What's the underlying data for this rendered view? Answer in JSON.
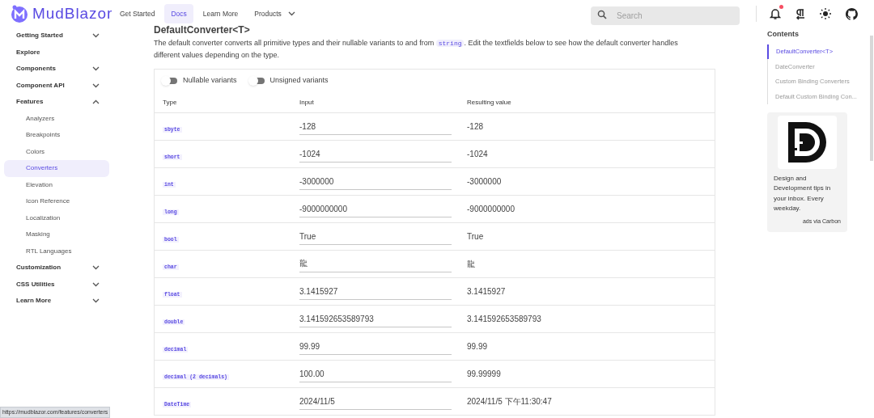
{
  "header": {
    "brand": "MudBlazor",
    "nav": [
      {
        "label": "Get Started",
        "selected": false,
        "dropdown": false
      },
      {
        "label": "Docs",
        "selected": true,
        "dropdown": false
      },
      {
        "label": "Learn More",
        "selected": false,
        "dropdown": false
      },
      {
        "label": "Products",
        "selected": false,
        "dropdown": true
      }
    ],
    "search": {
      "placeholder": "Search"
    },
    "notification_unread": true
  },
  "sidebar": {
    "items": [
      {
        "label": "Getting Started",
        "expanded": false,
        "selected": false
      },
      {
        "label": "Explore",
        "selected": false
      },
      {
        "label": "Components",
        "expanded": false,
        "selected": false
      },
      {
        "label": "Component API",
        "expanded": false,
        "selected": false
      },
      {
        "label": "Features",
        "expanded": true,
        "selected": false,
        "children": [
          {
            "label": "Analyzers",
            "selected": false
          },
          {
            "label": "Breakpoints",
            "selected": false
          },
          {
            "label": "Colors",
            "selected": false
          },
          {
            "label": "Converters",
            "selected": true
          },
          {
            "label": "Elevation",
            "selected": false
          },
          {
            "label": "Icon Reference",
            "selected": false
          },
          {
            "label": "Localization",
            "selected": false
          },
          {
            "label": "Masking",
            "selected": false
          },
          {
            "label": "RTL Languages",
            "selected": false
          }
        ]
      },
      {
        "label": "Customization",
        "expanded": false,
        "selected": false
      },
      {
        "label": "CSS Utilities",
        "expanded": false,
        "selected": false
      },
      {
        "label": "Learn More",
        "expanded": false,
        "selected": false
      }
    ]
  },
  "main": {
    "heading": "DefaultConverter<T>",
    "description": [
      "The default converter converts all primitive types and their nullable variants to and from ",
      "string",
      ". Edit the textfields below to see how the default converter handles different values depending on the type."
    ],
    "switches": [
      {
        "label": "Nullable variants",
        "on": false
      },
      {
        "label": "Unsigned variants",
        "on": false
      }
    ],
    "table": {
      "columns": [
        "Type",
        "Input",
        "Resulting value"
      ],
      "rows": [
        {
          "type": "sbyte",
          "input": "-128",
          "result": "-128"
        },
        {
          "type": "short",
          "input": "-1024",
          "result": "-1024"
        },
        {
          "type": "int",
          "input": "-3000000",
          "result": "-3000000"
        },
        {
          "type": "long",
          "input": "-9000000000",
          "result": "-9000000000"
        },
        {
          "type": "bool",
          "input": "True",
          "result": "True"
        },
        {
          "type": "char",
          "input": "龍",
          "result": "龍"
        },
        {
          "type": "float",
          "input": "3.1415927",
          "result": "3.1415927"
        },
        {
          "type": "double",
          "input": "3.141592653589793",
          "result": "3.141592653589793"
        },
        {
          "type": "decimal",
          "input": "99.99",
          "result": "99.99"
        },
        {
          "type": "decimal (2 decimals)",
          "input": "100.00",
          "result": "99.99999"
        },
        {
          "type": "DateTime",
          "input": "2024/11/5",
          "result": "2024/11/5 下午11:30:47"
        }
      ]
    }
  },
  "contents": {
    "title": "Contents",
    "items": [
      {
        "label": "DefaultConverter<T>",
        "selected": true
      },
      {
        "label": "DateConverter",
        "selected": false
      },
      {
        "label": "Custom Binding Converters",
        "selected": false
      },
      {
        "label": "Default Custom Binding Con...",
        "selected": false
      }
    ]
  },
  "ad": {
    "text": "Design and Development tips in your inbox. Every weekday.",
    "credit": "ads via Carbon"
  },
  "status_url": "https://mudblazor.com/features/converters"
}
